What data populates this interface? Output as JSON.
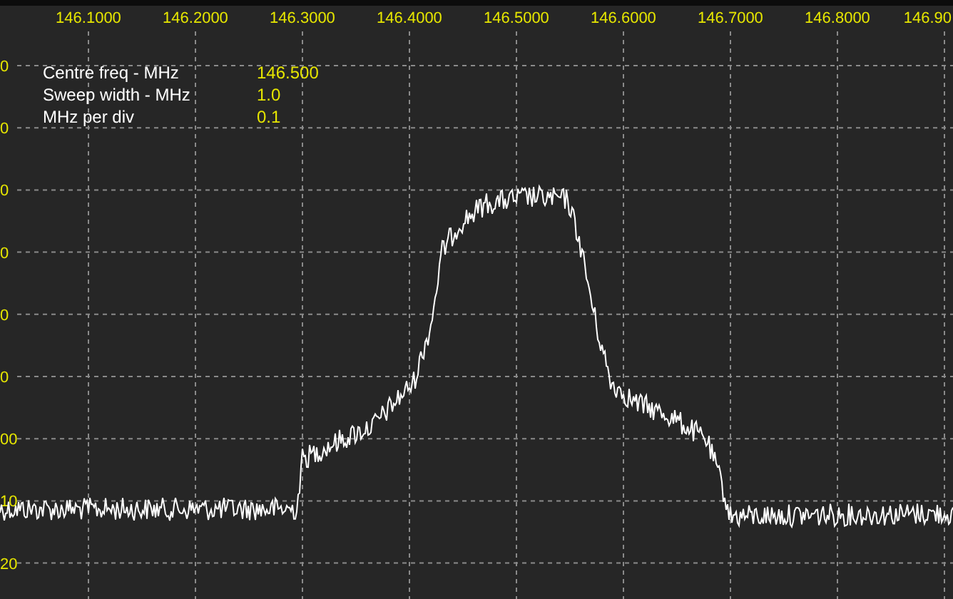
{
  "x_axis_labels": [
    "146.1000",
    "146.2000",
    "146.3000",
    "146.4000",
    "146.5000",
    "146.6000",
    "146.7000",
    "146.8000",
    "146.90"
  ],
  "y_axis_labels": [
    "0",
    "0",
    "0",
    "0",
    "0",
    "0",
    "00",
    "10",
    "20"
  ],
  "info": [
    {
      "label": "Centre freq - MHz",
      "value": "146.500"
    },
    {
      "label": "Sweep width - MHz",
      "value": "1.0"
    },
    {
      "label": "MHz per div",
      "value": "0.1"
    }
  ]
}
